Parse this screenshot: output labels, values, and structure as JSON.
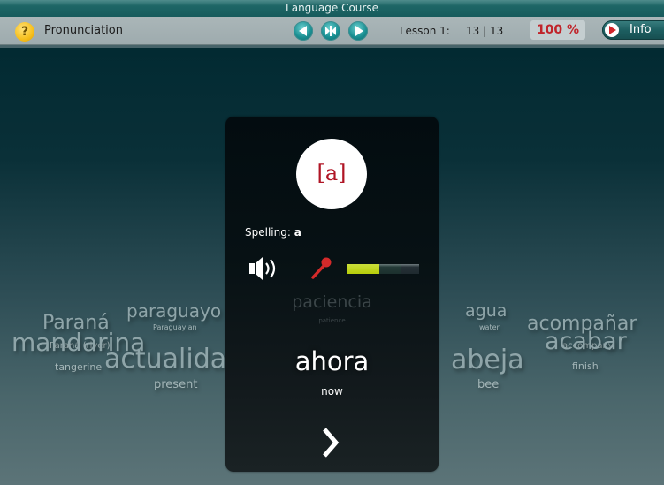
{
  "window": {
    "title": "Language Course"
  },
  "toolbar": {
    "help_icon": "?",
    "section_title": "Pronunciation",
    "nav": {
      "back": "back-icon",
      "skip": "skip-icon",
      "forward": "forward-icon"
    },
    "lesson_label": "Lesson 1:",
    "lesson_count": "13 | 13",
    "score": "100 %",
    "info_label": "Info"
  },
  "card": {
    "phoneme": "[a]",
    "spelling_label": "Spelling:",
    "spelling_value": "a",
    "recording_level": 0.45,
    "previous_word": "paciencia",
    "previous_translation": "patience",
    "current_word": "ahora",
    "current_translation": "now",
    "next_icon": "chevron-right-icon"
  },
  "colors": {
    "accent": "#1a8f92",
    "score_red": "#c0242a",
    "phoneme_red": "#b01525",
    "level_green": "#b7cd0a"
  },
  "word_cloud": [
    {
      "word": "Paraná",
      "translation": "Paraná (river)"
    },
    {
      "word": "paraguayo",
      "translation": "Paraguayian"
    },
    {
      "word": "mandarina",
      "translation": "tangerine"
    },
    {
      "word": "actualidad",
      "translation": "present"
    },
    {
      "word": "agua",
      "translation": "water"
    },
    {
      "word": "acompañar",
      "translation": "accompany"
    },
    {
      "word": "acabar",
      "translation": "finish"
    },
    {
      "word": "abeja",
      "translation": "bee"
    }
  ]
}
